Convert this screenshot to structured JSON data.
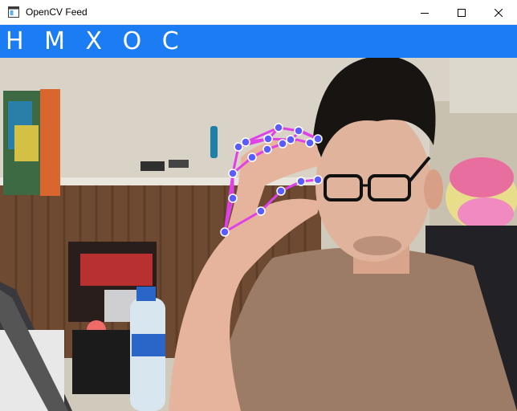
{
  "window": {
    "title": "OpenCV Feed",
    "icons": {
      "app": "opencv-window-icon",
      "minimize": "minimize-icon",
      "maximize": "maximize-icon",
      "close": "close-icon"
    }
  },
  "banner": {
    "text": "H M X O C",
    "background": "#1c7cf4",
    "text_color": "#ffffff"
  },
  "feed": {
    "content": "webcam frame with hand landmark overlay",
    "landmark_color": "#5a5cff",
    "connection_color": "#e040e8"
  }
}
